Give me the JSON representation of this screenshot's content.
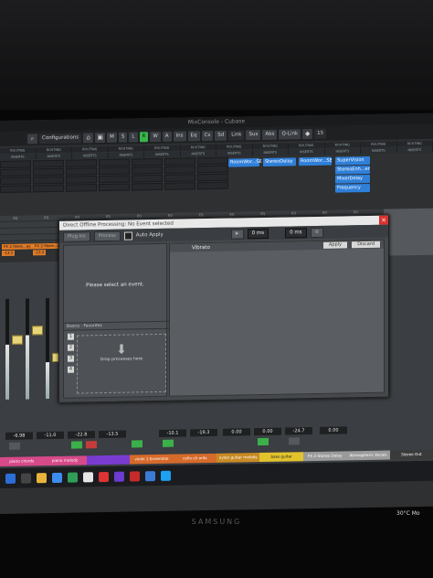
{
  "window": {
    "title": "MixConsole - Cubase"
  },
  "toolbar": {
    "configurations": "Configurations",
    "mode_buttons": [
      "M",
      "S",
      "L",
      "R",
      "W",
      "A"
    ],
    "view_buttons": [
      "Ins",
      "Eq",
      "Cs",
      "Sd"
    ],
    "link": "Link",
    "sus": "Sus",
    "abs": "Abs",
    "qlink": "Q-Link",
    "channel_count": "15"
  },
  "routing_label": "ROUTING",
  "inserts_label": "INSERTS",
  "plugins": [
    {
      "name": "RoomWor...SE"
    },
    {
      "name": "StereoDelay"
    },
    {
      "name": "RoomWor...SE"
    },
    {
      "name": "SuperVision"
    },
    {
      "name": "StereoEnh...er"
    },
    {
      "name": "MixerDelay"
    },
    {
      "name": "Frequency"
    }
  ],
  "mid_labels": [
    "EQ",
    "EQ",
    "EQ",
    "EQ",
    "EQ",
    "EQ",
    "EQ",
    "EQ",
    "EQ",
    "EQ",
    "EQ",
    "EQ",
    "EQ",
    "EQ"
  ],
  "fx_buttons": [
    "FX 2-Stere...ay",
    "FX 2-Stere...ay",
    "-13.5",
    "-13.5"
  ],
  "dialog": {
    "title": "Direct Offline Processing: No Event selected",
    "plugins_btn": "Plug-ins",
    "process_btn": "Process",
    "auto_apply": "Auto Apply",
    "time1": "0 ms",
    "time2": "0 ms",
    "placeholder": "Please select an event.",
    "favorites_header": "Basics · Favorites",
    "drop_text": "Drop processes here",
    "numbers": [
      "1",
      "2",
      "3",
      "4"
    ],
    "process_title": "Vibrato",
    "apply": "Apply",
    "discard": "Discard"
  },
  "db_values": [
    "-6.98",
    "-11.0",
    "-22.8",
    "-13.5",
    "-10.1",
    "-19.3",
    "0.00",
    "0.00",
    "-24.7",
    "0.00"
  ],
  "channel_labels": [
    "piano chords",
    "piano melody",
    "",
    "violin 1 Ensemble",
    "cello ch ords",
    "nylon guitar melody",
    "bass guitar",
    "FX 2-Stereo Delay",
    "Atmospheric Vocals",
    "Stereo Out"
  ],
  "taskbar": {
    "temp": "30°C",
    "extra": "Mo"
  },
  "brand": "SAMSUNG",
  "colors": {
    "accent_blue": "#2f7fd9",
    "fader_yellow": "#e8d47a",
    "green": "#3cb04a",
    "red": "#c43b3b",
    "orange": "#e07b27"
  }
}
